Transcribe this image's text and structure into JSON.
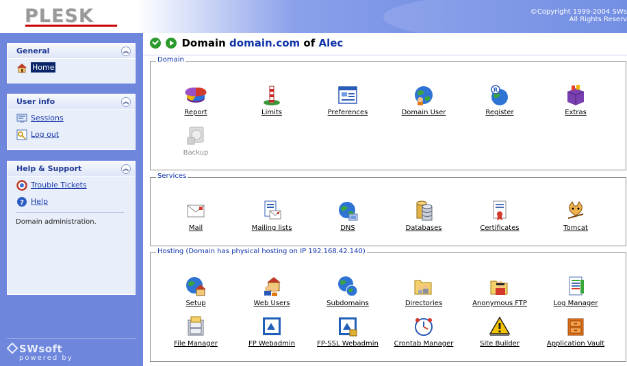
{
  "header": {
    "logo": "PLESK",
    "copyright_line1": "©Copyright 1999-2004 SWs",
    "copyright_line2": "All Rights Reserv"
  },
  "sidebar": {
    "general": {
      "title": "General",
      "items": [
        {
          "label": "Home",
          "icon": "home-icon"
        }
      ]
    },
    "user_info": {
      "title": "User info",
      "items": [
        {
          "label": "Sessions",
          "icon": "sessions-icon"
        },
        {
          "label": "Log out",
          "icon": "logout-key-icon"
        }
      ]
    },
    "help": {
      "title": "Help & Support",
      "items": [
        {
          "label": "Trouble Tickets",
          "icon": "trouble-tickets-icon"
        },
        {
          "label": "Help",
          "icon": "help-icon"
        }
      ],
      "note": "Domain administration."
    },
    "footer": {
      "brand": "SWsoft",
      "sub": "powered by"
    }
  },
  "main": {
    "title": {
      "prefix": "Domain",
      "domain": "domain.com",
      "of": "of",
      "owner": "Alec"
    },
    "groups": {
      "domain": {
        "legend": "Domain",
        "tiles": [
          "Report",
          "Limits",
          "Preferences",
          "Domain User",
          "Register",
          "Extras",
          "Backup"
        ]
      },
      "services": {
        "legend": "Services",
        "tiles": [
          "Mail",
          "Mailing lists",
          "DNS",
          "Databases",
          "Certificates",
          "Tomcat"
        ]
      },
      "hosting": {
        "legend": "Hosting (Domain has physical hosting on IP 192.168.42.140)",
        "tiles": [
          "Setup",
          "Web Users",
          "Subdomains",
          "Directories",
          "Anonymous FTP",
          "Log Manager",
          "File Manager",
          "FP Webadmin",
          "FP-SSL Webadmin",
          "Crontab Manager",
          "Site Builder",
          "Application Vault"
        ]
      }
    }
  },
  "colors": {
    "sidebar_bg": "#6e87dd",
    "panel_bg": "#e9eefb",
    "link": "#1a3ca8",
    "title_blue": "#1033a8",
    "logo_red": "#cc0000"
  }
}
